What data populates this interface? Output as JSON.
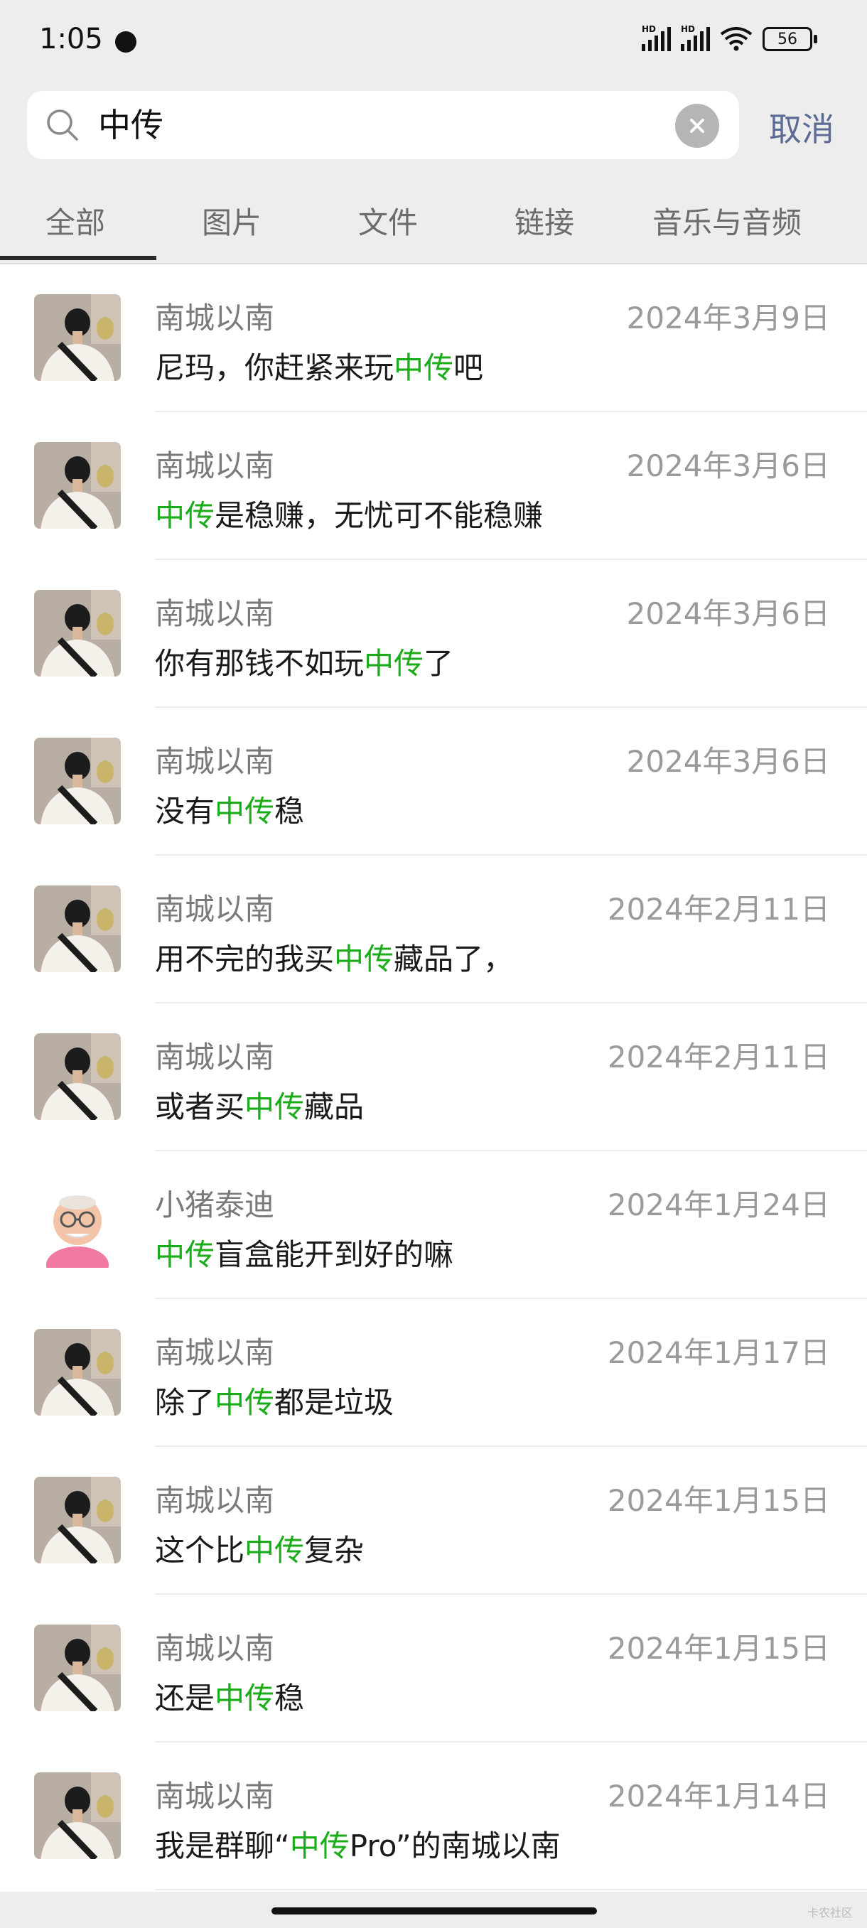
{
  "status": {
    "time": "1:05",
    "battery": "56",
    "hd1": "HD",
    "hd2": "HD"
  },
  "search": {
    "query": "中传",
    "cancel_label": "取消"
  },
  "tabs": [
    {
      "label": "全部"
    },
    {
      "label": "图片"
    },
    {
      "label": "文件"
    },
    {
      "label": "链接"
    },
    {
      "label": "音乐与音频"
    }
  ],
  "results": [
    {
      "name": "南城以南",
      "date": "2024年3月9日",
      "pre": "尼玛，你赶紧来玩",
      "hl": "中传",
      "post": "吧",
      "avatar": "boy"
    },
    {
      "name": "南城以南",
      "date": "2024年3月6日",
      "pre": "",
      "hl": "中传",
      "post": "是稳赚，无忧可不能稳赚",
      "avatar": "boy"
    },
    {
      "name": "南城以南",
      "date": "2024年3月6日",
      "pre": "你有那钱不如玩",
      "hl": "中传",
      "post": "了",
      "avatar": "boy"
    },
    {
      "name": "南城以南",
      "date": "2024年3月6日",
      "pre": "没有",
      "hl": "中传",
      "post": "稳",
      "avatar": "boy"
    },
    {
      "name": "南城以南",
      "date": "2024年2月11日",
      "pre": "用不完的我买",
      "hl": "中传",
      "post": "藏品了，",
      "avatar": "boy"
    },
    {
      "name": "南城以南",
      "date": "2024年2月11日",
      "pre": "或者买",
      "hl": "中传",
      "post": "藏品",
      "avatar": "boy"
    },
    {
      "name": "小猪泰迪",
      "date": "2024年1月24日",
      "pre": "",
      "hl": "中传",
      "post": "盲盒能开到好的嘛",
      "avatar": "grandpa"
    },
    {
      "name": "南城以南",
      "date": "2024年1月17日",
      "pre": "除了",
      "hl": "中传",
      "post": "都是垃圾",
      "avatar": "boy"
    },
    {
      "name": "南城以南",
      "date": "2024年1月15日",
      "pre": "这个比",
      "hl": "中传",
      "post": "复杂",
      "avatar": "boy"
    },
    {
      "name": "南城以南",
      "date": "2024年1月15日",
      "pre": "还是",
      "hl": "中传",
      "post": "稳",
      "avatar": "boy"
    },
    {
      "name": "南城以南",
      "date": "2024年1月14日",
      "pre": "我是群聊“",
      "hl": "中传",
      "post": "Pro”的南城以南",
      "avatar": "boy"
    }
  ],
  "colors": {
    "highlight": "#1aad19",
    "cancel": "#5b6b93"
  },
  "watermark": "卡农社区"
}
